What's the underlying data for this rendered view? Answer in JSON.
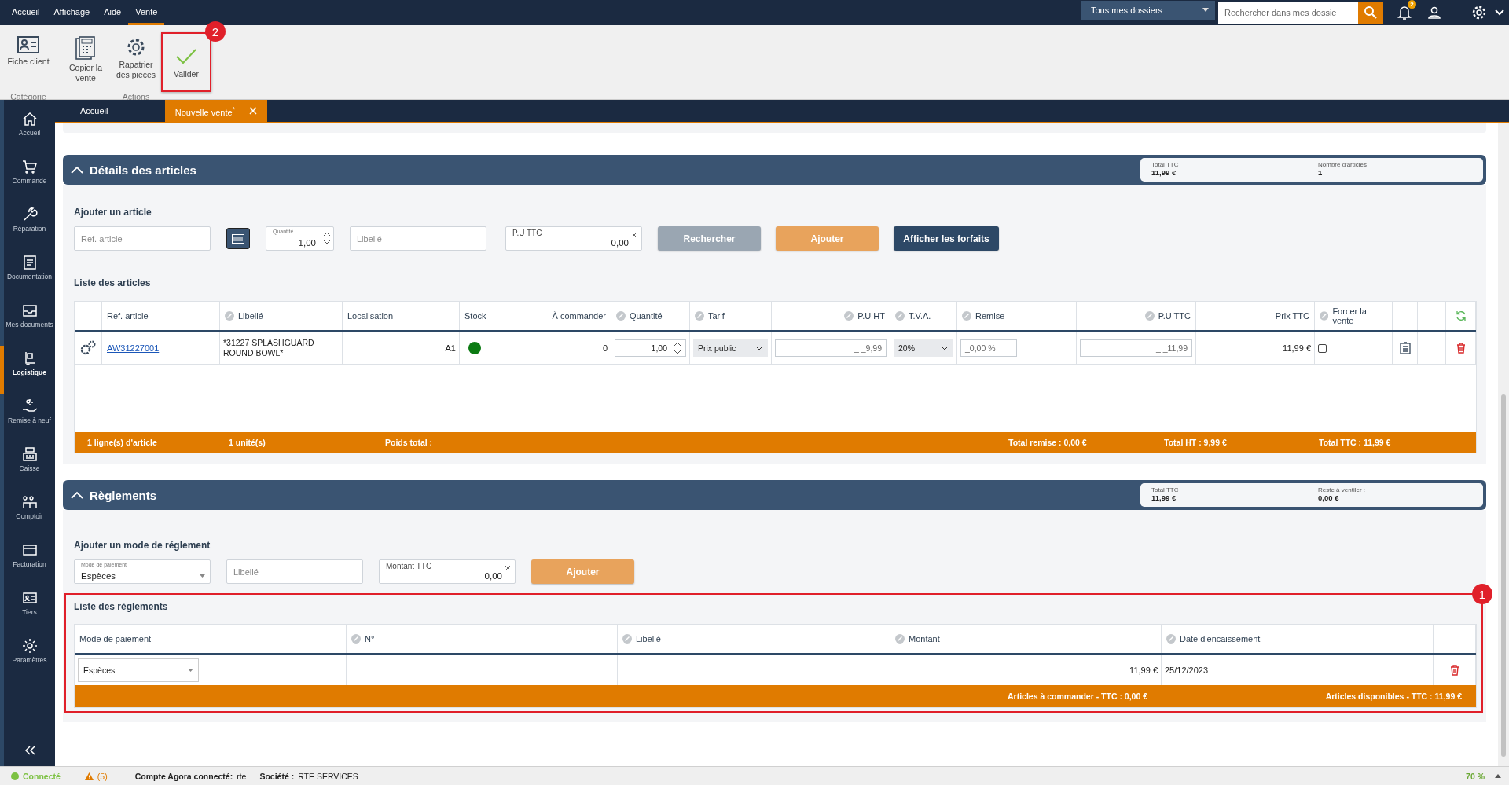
{
  "menu": [
    {
      "label": "Accueil",
      "selected": false
    },
    {
      "label": "Affichage",
      "selected": false
    },
    {
      "label": "Aide",
      "selected": false
    },
    {
      "label": "Vente",
      "selected": true
    }
  ],
  "folder_select": {
    "value": "Tous mes dossiers"
  },
  "search": {
    "placeholder": "Rechercher dans mes dossie"
  },
  "notifications": {
    "count": "2"
  },
  "ribbon": [
    {
      "label": "Catégorie",
      "buttons": [
        {
          "label": "Fiche client",
          "highlighted": false
        }
      ]
    },
    {
      "label": "Actions",
      "buttons": [
        {
          "label": "Copier la vente",
          "highlighted": false
        },
        {
          "label": "Rapatrier des pièces",
          "highlighted": false
        },
        {
          "label": "Valider",
          "highlighted": true,
          "annotation": "2"
        }
      ]
    }
  ],
  "doc_tabs": [
    {
      "label": "Accueil",
      "selected": false,
      "closable": false
    },
    {
      "label": "Nouvelle vente$^{*}$",
      "selected": true,
      "closable": true
    }
  ],
  "sidebar": [
    {
      "label": "Accueil",
      "selected": false
    },
    {
      "label": "Commande",
      "selected": false
    },
    {
      "label": "Réparation",
      "selected": false
    },
    {
      "label": "Documentation",
      "selected": false
    },
    {
      "label": "Mes documents",
      "selected": false
    },
    {
      "label": "Logistique",
      "selected": true
    },
    {
      "label": "Remise à neuf",
      "selected": false
    },
    {
      "label": "Caisse",
      "selected": false
    },
    {
      "label": "Comptoir",
      "selected": false
    },
    {
      "label": "Facturation",
      "selected": false
    },
    {
      "label": "Tiers",
      "selected": false
    },
    {
      "label": "Paramètres",
      "selected": false
    }
  ],
  "articles": {
    "title": "Détails des articles",
    "expanded": true,
    "summary": [
      {
        "label": "Total TTC",
        "value": "11,99 €"
      },
      {
        "label": "Nombre d'articles",
        "value": "1"
      }
    ],
    "add_title": "Ajouter un article",
    "ref_field": {
      "placeholder": "Ref. article"
    },
    "quantity_field": {
      "label": "Quantité",
      "value": "1,00"
    },
    "label_field": {
      "placeholder": "Libellé"
    },
    "price_field": {
      "label": "P.U TTC",
      "value": "0,00"
    },
    "buttons": [
      {
        "label": "Rechercher",
        "kind": "secondary",
        "disabled": true
      },
      {
        "label": "Ajouter",
        "kind": "primary",
        "disabled": true
      },
      {
        "label": "Afficher les forfaits",
        "kind": "dark",
        "disabled": false
      }
    ],
    "list_title": "Liste des articles",
    "columns": [
      {
        "label": "Ref. article",
        "editable": false
      },
      {
        "label": "Libellé",
        "editable": true
      },
      {
        "label": "Localisation",
        "editable": false
      },
      {
        "label": "Stock",
        "editable": false
      },
      {
        "label": "À commander",
        "editable": false
      },
      {
        "label": "Quantité",
        "editable": true
      },
      {
        "label": "Tarif",
        "editable": true
      },
      {
        "label": "P.U HT",
        "editable": true
      },
      {
        "label": "T.V.A.",
        "editable": true
      },
      {
        "label": "Remise",
        "editable": true
      },
      {
        "label": "P.U TTC",
        "editable": true
      },
      {
        "label": "Prix TTC",
        "editable": false
      },
      {
        "label": "Forcer la vente",
        "editable": true
      }
    ],
    "rows": [
      {
        "ref": "AW31227001",
        "label": "*31227 SPLASHGUARD ROUND BOWL*",
        "location": "A1",
        "color": "#0b7a12",
        "to_order": "0",
        "quantity": "1,00",
        "tariff": "Prix public",
        "price_ht": "_ _9,99",
        "vat": "20%",
        "discount": "_0,00 %",
        "price_ttc": "_ _11,99",
        "total": "11,99 €",
        "force_sale": false
      }
    ],
    "footer": [
      "1 ligne(s) d'article",
      "1 unité(s)",
      "Poids total :",
      "Total remise : 0,00 €",
      "Total HT : 9,99 €",
      "Total TTC : 11,99 €"
    ]
  },
  "payments": {
    "title": "Règlements",
    "expanded": true,
    "summary": [
      {
        "label": "Total TTC",
        "value": "11,99 €"
      },
      {
        "label": "Reste à ventiler :",
        "value": "0,00 €"
      }
    ],
    "add_title": "Ajouter un mode de réglement",
    "mode_field": {
      "label": "Mode de paiement",
      "value": "Espèces"
    },
    "label_field": {
      "placeholder": "Libellé"
    },
    "amount_field": {
      "label": "Montant TTC",
      "value": "0,00"
    },
    "add_button": {
      "label": "Ajouter",
      "disabled": true
    },
    "list_title": "Liste des règlements",
    "annotation": "1",
    "columns": [
      {
        "label": "Mode de paiement",
        "editable": false
      },
      {
        "label": "N°",
        "editable": true
      },
      {
        "label": "Libellé",
        "editable": true
      },
      {
        "label": "Montant",
        "editable": true
      },
      {
        "label": "Date d'encaissement",
        "editable": true
      }
    ],
    "rows": [
      {
        "mode": "Espèces",
        "amount": "11,99 €",
        "date": "25/12/2023"
      }
    ],
    "footer": [
      "Articles à commander - TTC : 0,00 €",
      "Articles disponibles - TTC : 11,99 €"
    ]
  },
  "status": {
    "connection": {
      "label": "Connecté",
      "color": "#7cc142"
    },
    "warnings": "(5)",
    "account": {
      "label": "Compte Agora connecté:",
      "value": "rte"
    },
    "company": {
      "label": "Société :",
      "value": "RTE SERVICES"
    },
    "zoom": "70 %"
  }
}
